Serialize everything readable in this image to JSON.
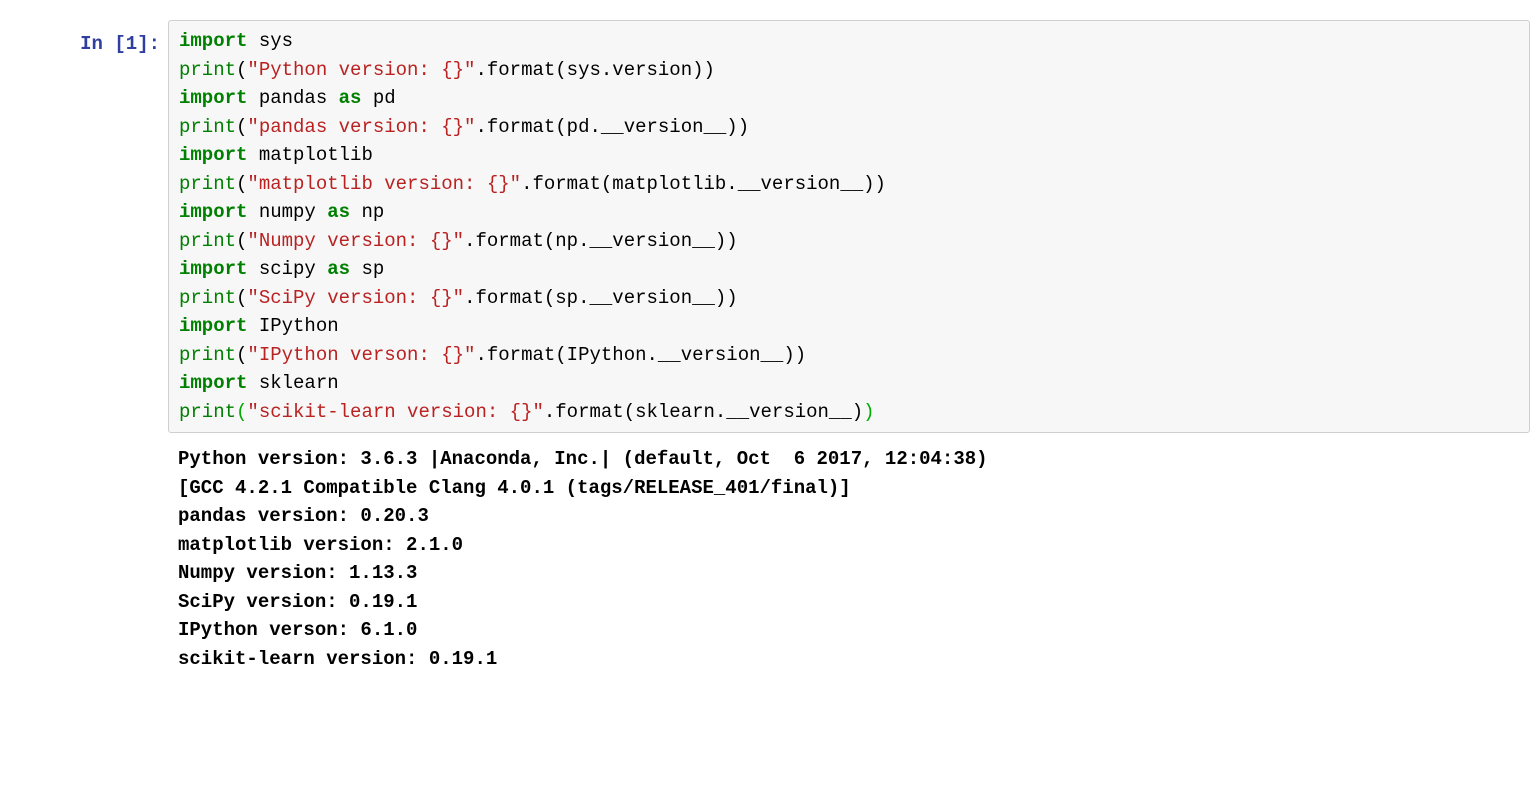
{
  "prompt": {
    "prefix": "In ",
    "open": "[",
    "num": "1",
    "close": "]:"
  },
  "code": {
    "l1": {
      "a": "import",
      "b": " sys"
    },
    "l2": {
      "a": "print",
      "b": "(",
      "c": "\"Python version: {}\"",
      "d": ".format(sys.version))"
    },
    "l3": {
      "a": "import",
      "b": " pandas ",
      "c": "as",
      "d": " pd"
    },
    "l4": {
      "a": "print",
      "b": "(",
      "c": "\"pandas version: {}\"",
      "d": ".format(pd.__version__))"
    },
    "l5": {
      "a": "import",
      "b": " matplotlib"
    },
    "l6": {
      "a": "print",
      "b": "(",
      "c": "\"matplotlib version: {}\"",
      "d": ".format(matplotlib.__version__))"
    },
    "l7": {
      "a": "import",
      "b": " numpy ",
      "c": "as",
      "d": " np"
    },
    "l8": {
      "a": "print",
      "b": "(",
      "c": "\"Numpy version: {}\"",
      "d": ".format(np.__version__))"
    },
    "l9": {
      "a": "import",
      "b": " scipy ",
      "c": "as",
      "d": " sp"
    },
    "l10": {
      "a": "print",
      "b": "(",
      "c": "\"SciPy version: {}\"",
      "d": ".format(sp.__version__))"
    },
    "l11": {
      "a": "import",
      "b": " IPython"
    },
    "l12": {
      "a": "print",
      "b": "(",
      "c": "\"IPython verson: {}\"",
      "d": ".format(IPython.__version__))"
    },
    "l13": {
      "a": "import",
      "b": " sklearn"
    },
    "l14": {
      "a": "print",
      "b": "(",
      "c": "\"scikit-learn version: {}\"",
      "d": ".format(sklearn.__version__)",
      "e": ")"
    }
  },
  "output": {
    "l1": "Python version: 3.6.3 |Anaconda, Inc.| (default, Oct  6 2017, 12:04:38) ",
    "l2": "[GCC 4.2.1 Compatible Clang 4.0.1 (tags/RELEASE_401/final)]",
    "l3": "pandas version: 0.20.3",
    "l4": "matplotlib version: 2.1.0",
    "l5": "Numpy version: 1.13.3",
    "l6": "SciPy version: 0.19.1",
    "l7": "IPython verson: 6.1.0",
    "l8": "scikit-learn version: 0.19.1"
  }
}
